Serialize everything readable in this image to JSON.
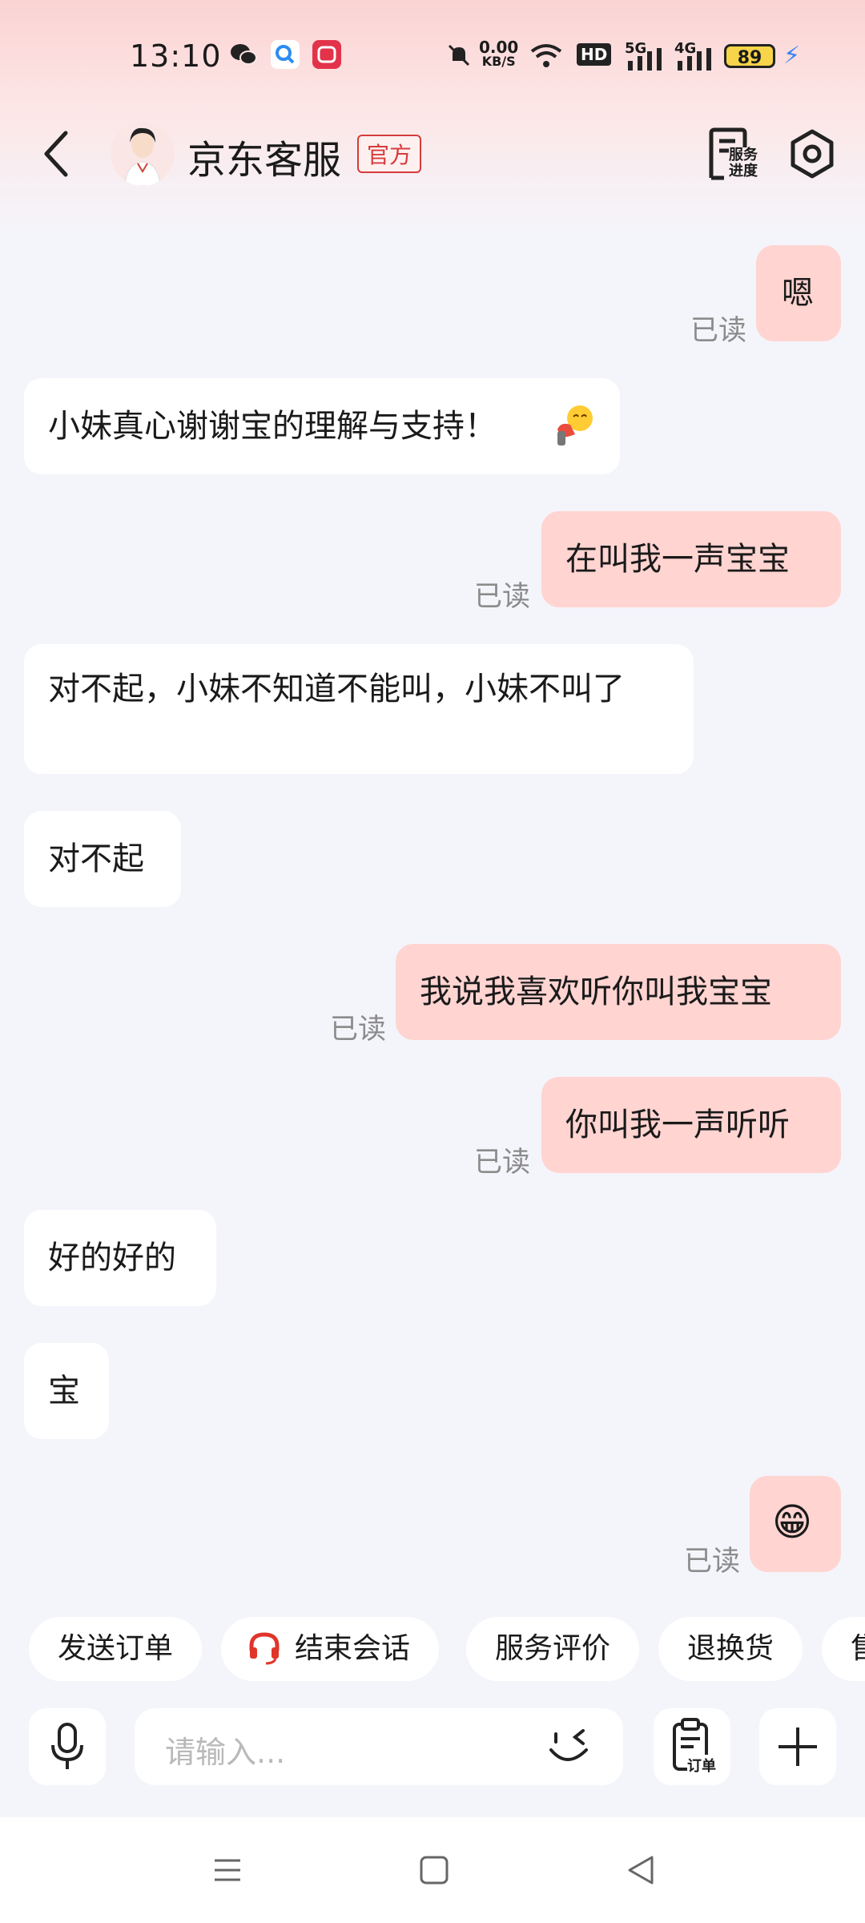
{
  "status_bar": {
    "time": "13:10",
    "net_speed_value": "0.00",
    "net_speed_unit": "KB/S",
    "hd_label": "HD",
    "signal1_label": "5G",
    "signal2_label": "4G",
    "battery": "89",
    "icons": [
      "wechat-icon",
      "search-app-icon",
      "app-icon",
      "mute-icon",
      "wifi-icon",
      "signal-icon",
      "battery-icon",
      "charging-icon"
    ]
  },
  "header": {
    "title": "京东客服",
    "badge": "官方",
    "service_progress_line1": "服务",
    "service_progress_line2": "进度"
  },
  "messages": [
    {
      "dir": "out",
      "text": "嗯",
      "read": "已读"
    },
    {
      "dir": "in",
      "text": "小妹真心谢谢宝的理解与支持！"
    },
    {
      "dir": "out",
      "text": "在叫我一声宝宝",
      "read": "已读"
    },
    {
      "dir": "in",
      "text": "对不起，小妹不知道不能叫，小妹不叫了"
    },
    {
      "dir": "in",
      "text": "对不起"
    },
    {
      "dir": "out",
      "text": "我说我喜欢听你叫我宝宝",
      "read": "已读"
    },
    {
      "dir": "out",
      "text": "你叫我一声听听",
      "read": "已读"
    },
    {
      "dir": "in",
      "text": "好的好的"
    },
    {
      "dir": "in",
      "text": "宝"
    },
    {
      "dir": "out",
      "text": "😁",
      "read": "已读"
    }
  ],
  "quick_actions": [
    "发送订单",
    "结束会话",
    "服务评价",
    "退换货",
    "售"
  ],
  "input": {
    "placeholder": "请输入...",
    "order_label": "订单"
  },
  "colors": {
    "outgoing_bubble": "#ffd4d1",
    "incoming_bubble": "#ffffff",
    "badge_red": "#d63b3b",
    "background": "#f4f5fb"
  }
}
